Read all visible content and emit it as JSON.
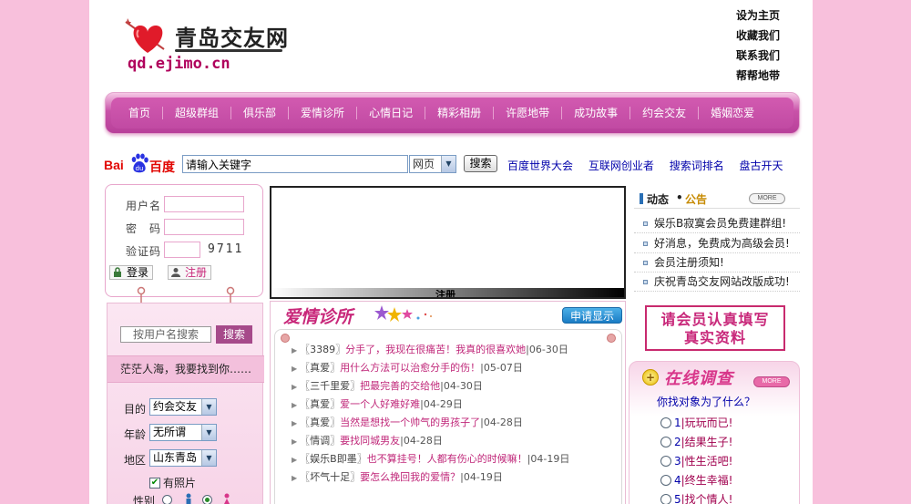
{
  "header": {
    "site_name": "青岛交友网",
    "domain": "qd.ejimo.cn",
    "top_links": [
      "设为主页",
      "收藏我们",
      "联系我们",
      "帮帮地带"
    ]
  },
  "nav": [
    "首页",
    "超级群组",
    "俱乐部",
    "爱情诊所",
    "心情日记",
    "精彩相册",
    "许愿地带",
    "成功故事",
    "约会交友",
    "婚姻恋爱"
  ],
  "search": {
    "brand_bai": "Bai",
    "brand_du": "百度",
    "keyword_value": "请输入关键字",
    "type_selected": "网页",
    "button": "搜索",
    "links": [
      "百度世界大会",
      "互联网创业者",
      "搜索词排名",
      "盘古开天"
    ]
  },
  "login": {
    "username_label": "用户名",
    "password_label": "密　码",
    "captcha_label": "验证码",
    "captcha_value": "9711",
    "login_button": "登录",
    "register_button": "注册"
  },
  "member_search": {
    "username_placeholder": "按用户名搜索",
    "button": "搜索",
    "slogan": "茫茫人海，我要找到你……",
    "purpose_label": "目的",
    "purpose_value": "约会交友",
    "age_label": "年龄",
    "age_value": "无所谓",
    "region_label": "地区",
    "region_value": "山东青岛",
    "photo_label": "有照片",
    "gender_label": "性别"
  },
  "flash": {
    "caption": "注册"
  },
  "clinic": {
    "title": "爱情诊所",
    "apply_button": "申请显示",
    "items": [
      {
        "tag": "〖3389〗",
        "title": "分手了，我现在很痛苦！我真的很喜欢她",
        "date": "|06-30日"
      },
      {
        "tag": "〖真爱〗",
        "title": "用什么方法可以治愈分手的伤！",
        "date": "|05-07日"
      },
      {
        "tag": "〖三千里爱〗",
        "title": "把最完善的交给他",
        "date": "|04-30日"
      },
      {
        "tag": "〖真爱〗",
        "title": "爱一个人好难好难",
        "date": "|04-29日"
      },
      {
        "tag": "〖真爱〗",
        "title": "当然是想找一个帅气的男孩子了",
        "date": "|04-28日"
      },
      {
        "tag": "〖情调〗",
        "title": "要找同城男友",
        "date": "|04-28日"
      },
      {
        "tag": "〖娱乐B即墨〗",
        "title": "也不算挂号！人都有伤心的时候嘛！",
        "date": "|04-19日"
      },
      {
        "tag": "〖坏气十足〗",
        "title": "要怎么挽回我的爱情？",
        "date": "|04-19日"
      }
    ]
  },
  "news": {
    "title_a": "动态",
    "dot": "•",
    "title_b": "公告",
    "more": "MORE",
    "items": [
      "娱乐B寂寞会员免费建群组!",
      "好消息，免费成为高级会员!",
      "会员注册须知!",
      "庆祝青岛交友网站改版成功!"
    ]
  },
  "banner": {
    "line1": "请会员认真填写",
    "line2": "真实资料"
  },
  "poll": {
    "title": "在线调查",
    "more": "MORE",
    "question": "你找对象为了什么？",
    "options": [
      {
        "num": "1",
        "text": "|玩玩而已!"
      },
      {
        "num": "2",
        "text": "|结果生子!"
      },
      {
        "num": "3",
        "text": "|性生活吧!"
      },
      {
        "num": "4",
        "text": "|终生幸福!"
      },
      {
        "num": "5",
        "text": "|找个情人!"
      }
    ]
  },
  "colors": {
    "page_bg": "#f8c0dc",
    "nav": "#c14aa3",
    "accent_pink": "#c8287a",
    "link_blue": "#0000aa"
  }
}
